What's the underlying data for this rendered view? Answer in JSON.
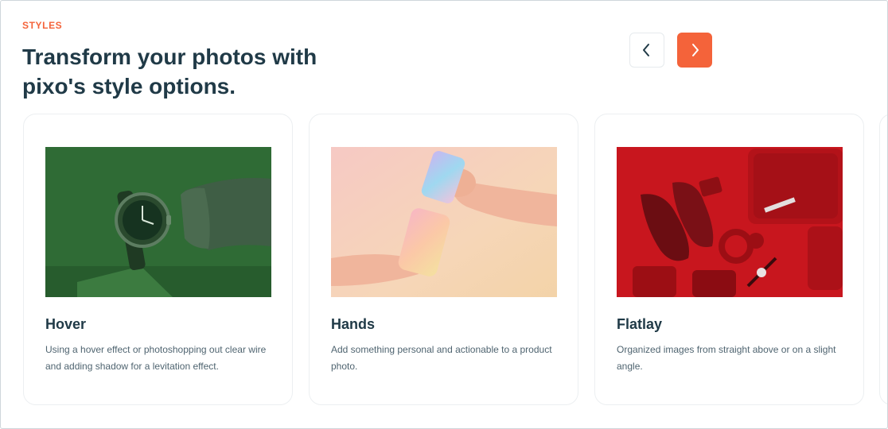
{
  "section": {
    "eyebrow": "STYLES",
    "title": "Transform your photos with pixo's style options."
  },
  "nav": {
    "prev_icon": "chevron-left-icon",
    "next_icon": "chevron-right-icon",
    "accent_color": "#f4633a"
  },
  "cards": [
    {
      "title": "Hover",
      "description": "Using a hover effect or photoshopping out clear wire and adding shadow for a levitation effect.",
      "image": "watch-hover-photo"
    },
    {
      "title": "Hands",
      "description": "Add something personal and actionable to a product photo.",
      "image": "hands-cans-photo"
    },
    {
      "title": "Flatlay",
      "description": "Organized images from straight above or on a slight angle.",
      "image": "red-flatlay-photo"
    }
  ]
}
